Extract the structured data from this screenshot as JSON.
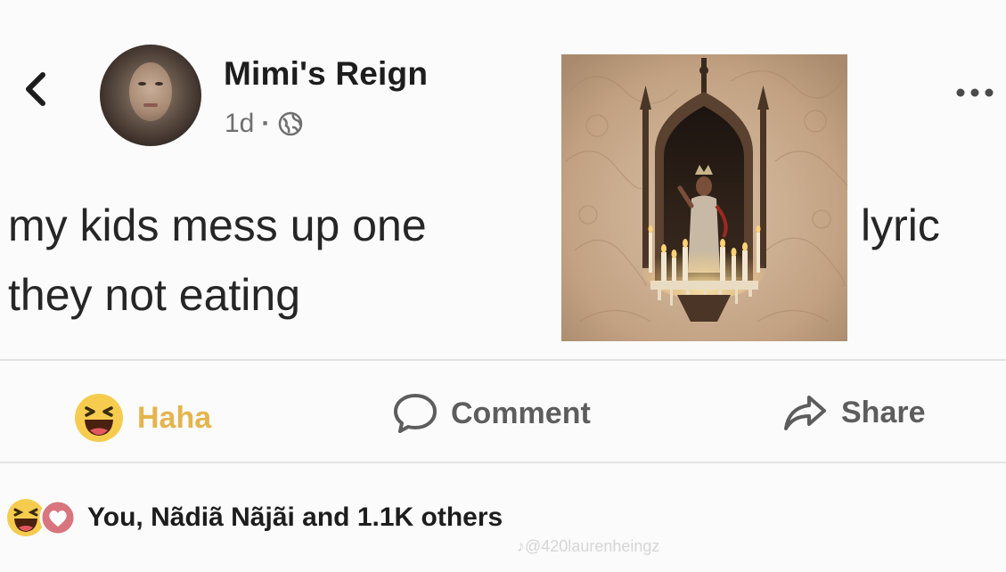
{
  "post": {
    "author": "Mimi's Reign",
    "time": "1d",
    "separator": "·",
    "privacy_icon": "globe-icon",
    "text_line1_start": "my kids mess up one",
    "text_line1_end": "lyric",
    "text_line2": "they not eating",
    "album_cover_description": ""
  },
  "actions": {
    "haha_label": "Haha",
    "comment_label": "Comment",
    "share_label": "Share"
  },
  "reactions": {
    "summary": "You, Nãdiã Nãjãi and 1.1K others",
    "icons": [
      "haha-icon",
      "love-icon"
    ]
  },
  "watermark": "♪@420laurenheingz",
  "colors": {
    "haha_yellow": "#e5b44e",
    "love_pink": "#d8757f",
    "text_dark": "#1d1d1d",
    "text_gray": "#6f6f6f"
  }
}
